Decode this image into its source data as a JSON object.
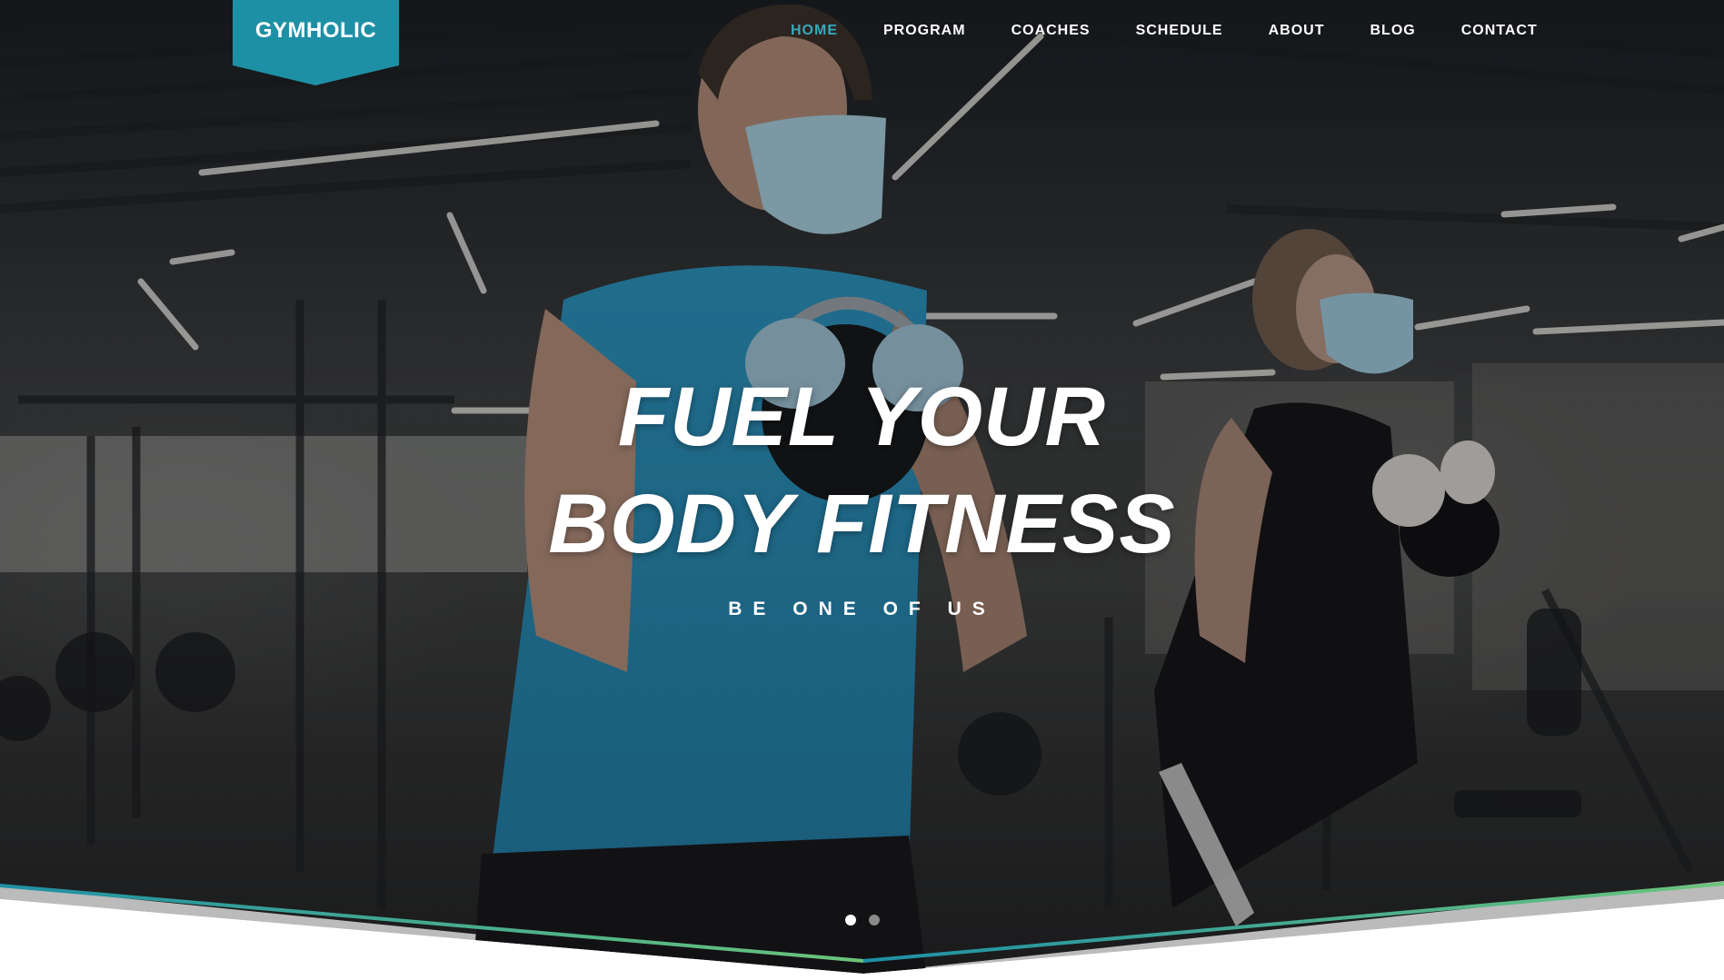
{
  "brand": {
    "logo_text": "GYMHOLIC",
    "accent_color": "#1e90a6",
    "nav_active_color": "#35a9bf",
    "divider_gradient": [
      "#1e90a6",
      "#6cc57a"
    ]
  },
  "nav": {
    "items": [
      {
        "label": "HOME",
        "active": true
      },
      {
        "label": "PROGRAM",
        "active": false
      },
      {
        "label": "COACHES",
        "active": false
      },
      {
        "label": "SCHEDULE",
        "active": false
      },
      {
        "label": "ABOUT",
        "active": false
      },
      {
        "label": "BLOG",
        "active": false
      },
      {
        "label": "CONTACT",
        "active": false
      }
    ]
  },
  "hero": {
    "headline_line1": "FUEL YOUR",
    "headline_line2": "BODY FITNESS",
    "tagline": "BE ONE OF US",
    "background_image": "gym-workout-photo",
    "slides": {
      "count": 2,
      "active_index": 0
    }
  }
}
